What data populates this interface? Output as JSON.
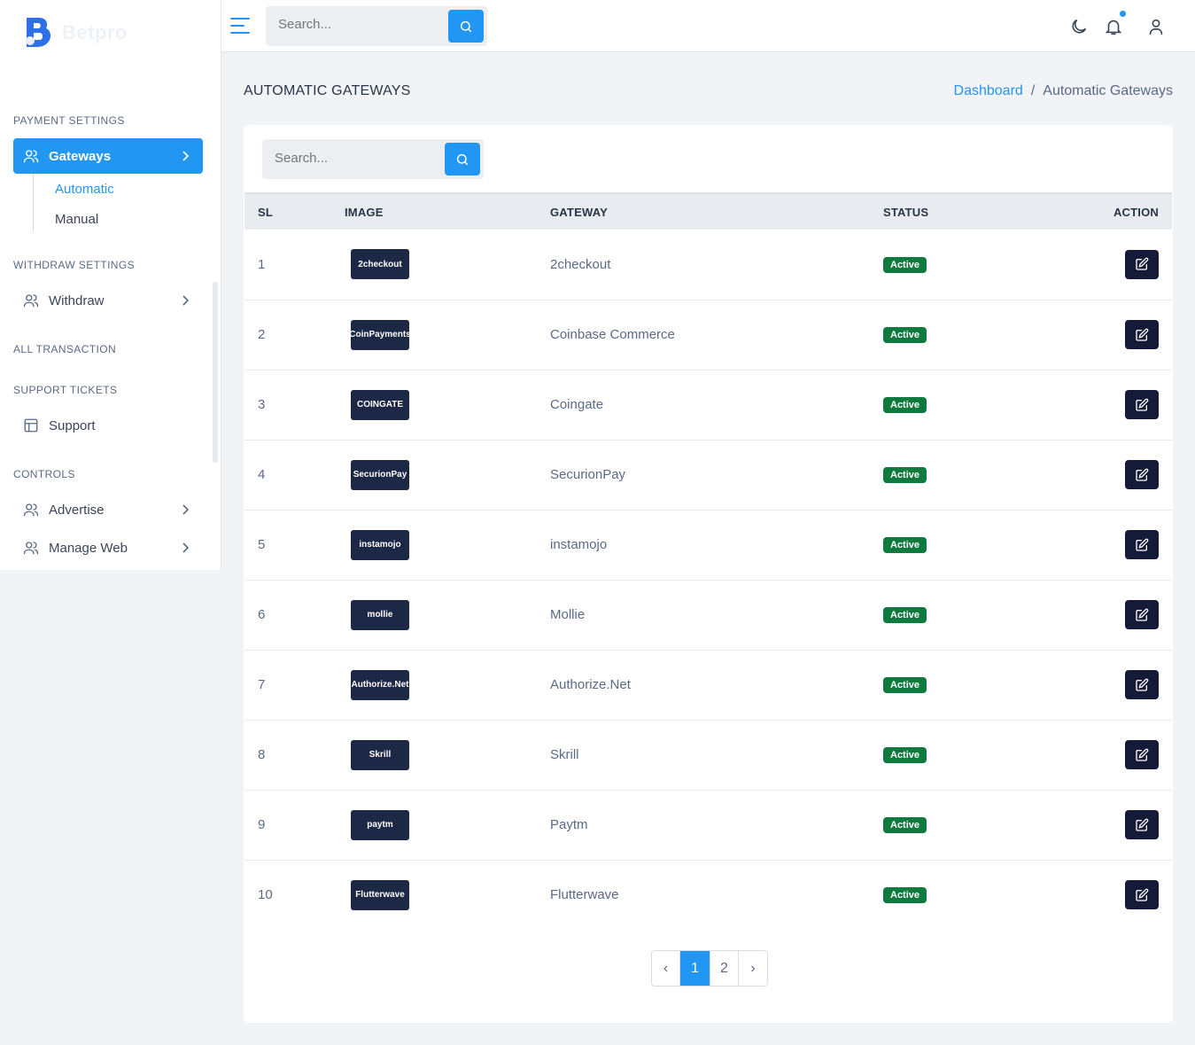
{
  "brand": {
    "name": "Betpro"
  },
  "topbar": {
    "search_placeholder": "Search..."
  },
  "sidebar": {
    "payment_title": "PAYMENT SETTINGS",
    "gateways_label": "Gateways",
    "gateway_subs": [
      "Automatic",
      "Manual"
    ],
    "withdraw_title": "WITHDRAW SETTINGS",
    "withdraw_label": "Withdraw",
    "transaction_title": "ALL TRANSACTION",
    "support_title": "SUPPORT TICKETS",
    "support_label": "Support",
    "controls_title": "CONTROLS",
    "advertise_label": "Advertise",
    "manageweb_label": "Manage Web"
  },
  "page": {
    "title": "AUTOMATIC GATEWAYS",
    "breadcrumb_home": "Dashboard",
    "breadcrumb_sep": "/",
    "breadcrumb_current": "Automatic Gateways"
  },
  "card": {
    "search_placeholder": "Search..."
  },
  "table": {
    "headers": [
      "SL",
      "IMAGE",
      "GATEWAY",
      "STATUS",
      "ACTION"
    ],
    "rows": [
      {
        "sl": "1",
        "logo_text": "2checkout",
        "gateway": "2checkout",
        "status": "Active"
      },
      {
        "sl": "2",
        "logo_text": "CoinPayments",
        "gateway": "Coinbase Commerce",
        "status": "Active"
      },
      {
        "sl": "3",
        "logo_text": "COINGATE",
        "gateway": "Coingate",
        "status": "Active"
      },
      {
        "sl": "4",
        "logo_text": "SecurionPay",
        "gateway": "SecurionPay",
        "status": "Active"
      },
      {
        "sl": "5",
        "logo_text": "instamojo",
        "gateway": "instamojo",
        "status": "Active"
      },
      {
        "sl": "6",
        "logo_text": "mollie",
        "gateway": "Mollie",
        "status": "Active"
      },
      {
        "sl": "7",
        "logo_text": "Authorize.Net",
        "gateway": "Authorize.Net",
        "status": "Active"
      },
      {
        "sl": "8",
        "logo_text": "Skrill",
        "gateway": "Skrill",
        "status": "Active"
      },
      {
        "sl": "9",
        "logo_text": "paytm",
        "gateway": "Paytm",
        "status": "Active"
      },
      {
        "sl": "10",
        "logo_text": "Flutterwave",
        "gateway": "Flutterwave",
        "status": "Active"
      }
    ]
  },
  "pagination": {
    "prev": "‹",
    "pages": [
      "1",
      "2"
    ],
    "next": "›",
    "current": "1"
  },
  "colors": {
    "accent": "#2196f3",
    "badge": "#0f7a3e",
    "edit_button": "#141a38",
    "logo_bg": "#1d2746"
  }
}
